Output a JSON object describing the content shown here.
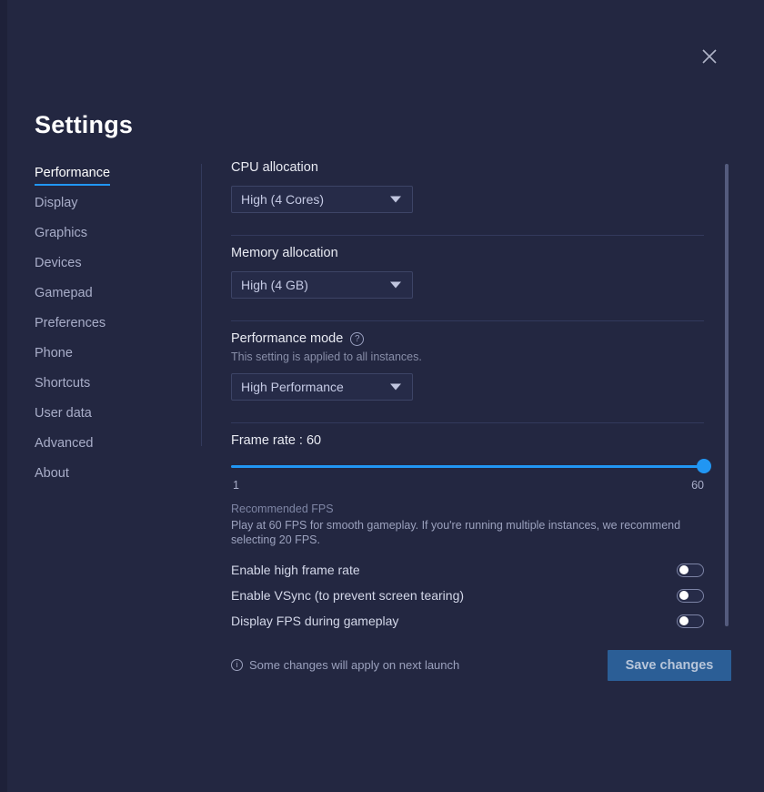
{
  "window": {
    "title": "Settings",
    "close_label": "×"
  },
  "sidebar": {
    "items": [
      {
        "label": "Performance",
        "active": true
      },
      {
        "label": "Display",
        "active": false
      },
      {
        "label": "Graphics",
        "active": false
      },
      {
        "label": "Devices",
        "active": false
      },
      {
        "label": "Gamepad",
        "active": false
      },
      {
        "label": "Preferences",
        "active": false
      },
      {
        "label": "Phone",
        "active": false
      },
      {
        "label": "Shortcuts",
        "active": false
      },
      {
        "label": "User data",
        "active": false
      },
      {
        "label": "Advanced",
        "active": false
      },
      {
        "label": "About",
        "active": false
      }
    ]
  },
  "main": {
    "cpu": {
      "label": "CPU allocation",
      "value": "High (4 Cores)"
    },
    "memory": {
      "label": "Memory allocation",
      "value": "High (4 GB)"
    },
    "performance_mode": {
      "label": "Performance mode",
      "help_glyph": "?",
      "note": "This setting is applied to all instances.",
      "value": "High Performance"
    },
    "frame_rate": {
      "label": "Frame rate : 60",
      "value": 60,
      "min": 1,
      "max": 60,
      "min_label": "1",
      "max_label": "60",
      "recommended_title": "Recommended FPS",
      "recommended_body": "Play at 60 FPS for smooth gameplay. If you're running multiple instances, we recommend selecting 20 FPS."
    },
    "toggles": [
      {
        "label": "Enable high frame rate",
        "on": false
      },
      {
        "label": "Enable VSync (to prevent screen tearing)",
        "on": false
      },
      {
        "label": "Display FPS during gameplay",
        "on": false
      }
    ]
  },
  "footer": {
    "info_glyph": "i",
    "note": "Some changes will apply on next launch",
    "save_label": "Save changes"
  },
  "colors": {
    "background": "#232741",
    "accent": "#2196f3",
    "save_button": "#2b5e96",
    "divider": "#333a5c"
  }
}
